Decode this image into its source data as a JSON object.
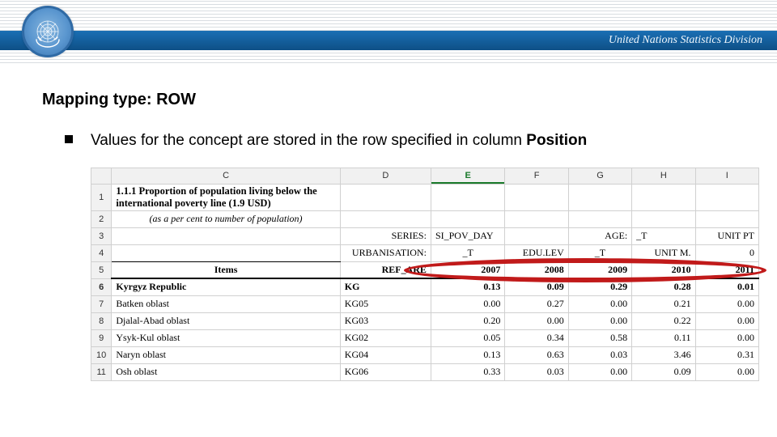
{
  "header": {
    "title": "United Nations Statistics Division"
  },
  "slide": {
    "heading": "Mapping type: ROW",
    "bullet_pre": "Values for the concept are stored in the row specified in column ",
    "bullet_bold": "Position"
  },
  "sheet": {
    "columns": [
      "",
      "C",
      "D",
      "E",
      "F",
      "G",
      "H",
      "I"
    ],
    "title_line1": "1.1.1 Proportion of population living below the",
    "title_line2": "international poverty line (1.9 USD)",
    "subtitle": "(as a per cent to number of population)",
    "row3": {
      "d": "SERIES:",
      "e": "SI_POV_DAY",
      "g": "AGE:",
      "h": "_T",
      "i": "UNIT PT"
    },
    "row4": {
      "d": "URBANISATION:",
      "e": "_T",
      "f": "EDU.LEV",
      "g": "_T",
      "h": "UNIT M.",
      "i": "0"
    },
    "row5": {
      "c": "Items",
      "d": "REF_ARE",
      "e": "2007",
      "f": "2008",
      "g": "2009",
      "h": "2010",
      "i": "2011"
    },
    "data_rows": [
      {
        "n": "6",
        "c": "Kyrgyz Republic",
        "d": "KG",
        "e": "0.13",
        "f": "0.09",
        "g": "0.29",
        "h": "0.28",
        "i": "0.01",
        "bold": true
      },
      {
        "n": "7",
        "c": "Batken oblast",
        "d": "KG05",
        "e": "0.00",
        "f": "0.27",
        "g": "0.00",
        "h": "0.21",
        "i": "0.00"
      },
      {
        "n": "8",
        "c": "Djalal-Abad oblast",
        "d": "KG03",
        "e": "0.20",
        "f": "0.00",
        "g": "0.00",
        "h": "0.22",
        "i": "0.00"
      },
      {
        "n": "9",
        "c": "Ysyk-Kul oblast",
        "d": "KG02",
        "e": "0.05",
        "f": "0.34",
        "g": "0.58",
        "h": "0.11",
        "i": "0.00"
      },
      {
        "n": "10",
        "c": "Naryn oblast",
        "d": "KG04",
        "e": "0.13",
        "f": "0.63",
        "g": "0.03",
        "h": "3.46",
        "i": "0.31"
      },
      {
        "n": "11",
        "c": "Osh oblast",
        "d": "KG06",
        "e": "0.33",
        "f": "0.03",
        "g": "0.00",
        "h": "0.09",
        "i": "0.00"
      }
    ]
  }
}
